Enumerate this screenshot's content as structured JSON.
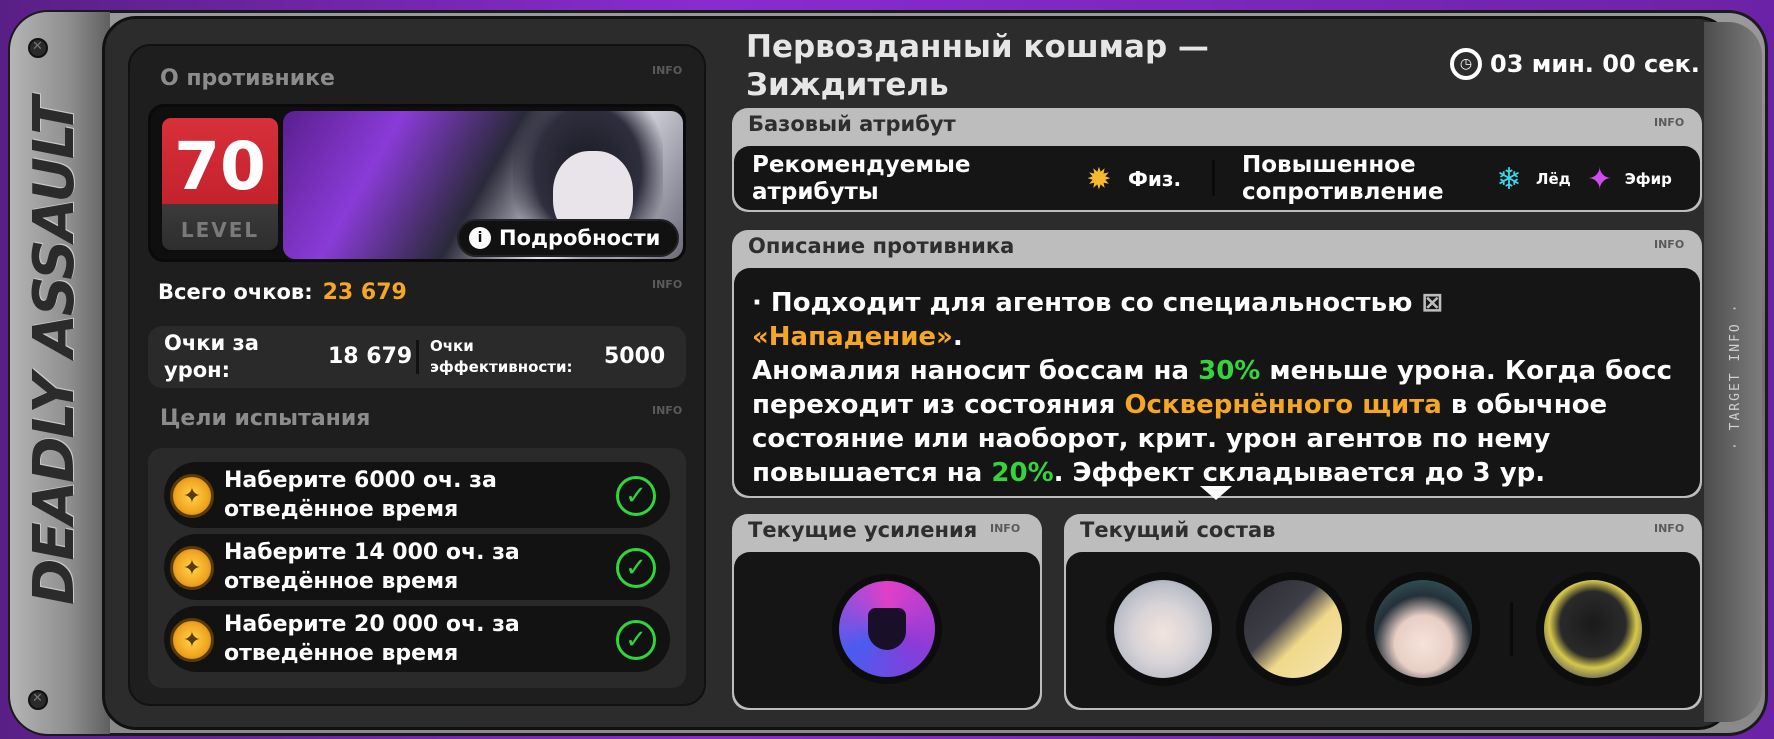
{
  "side_title": "DEADLY ASSAULT",
  "right_rail_text": "· TARGET INFO ·",
  "info_tag": "INFO",
  "enemy": {
    "section_label": "О противнике",
    "level": "70",
    "level_word": "LEVEL",
    "details_label": "Подробности"
  },
  "scores": {
    "total_label": "Всего очков:",
    "total_value": "23 679",
    "damage_label": "Очки за урон:",
    "damage_value": "18 679",
    "efficiency_label": "Очки эффективности:",
    "efficiency_value": "5000"
  },
  "goals": {
    "section_label": "Цели испытания",
    "items": [
      {
        "text": "Наберите 6000 оч. за отведённое время",
        "done": true
      },
      {
        "text": "Наберите 14 000 оч. за отведённое время",
        "done": true
      },
      {
        "text": "Наберите 20 000 оч. за отведённое время",
        "done": true
      }
    ]
  },
  "boss": {
    "title": "Первозданный кошмар — Зиждитель",
    "timer": "03 мин. 00 сек."
  },
  "attributes": {
    "tab_label": "Базовый атрибут",
    "recommended_label": "Рекомендуемые атрибуты",
    "recommended": [
      {
        "name": "Физ.",
        "icon": "physical-icon",
        "color": "#f5b82e"
      }
    ],
    "resistance_label": "Повышенное сопротивление",
    "resistances": [
      {
        "name": "Лёд",
        "icon": "ice-icon",
        "color": "#3ad7e8"
      },
      {
        "name": "Эфир",
        "icon": "ether-icon",
        "color": "#d14cf0"
      }
    ]
  },
  "description": {
    "tab_label": "Описание противника",
    "line1": "· Подходит для агентов со специальностью",
    "specialty": "«Нападение»",
    "p1": "Аномалия наносит боссам на",
    "pct1": "30%",
    "p2": "меньше урона. Когда босс переходит из состояния",
    "shield": "Осквернённого щита",
    "p3": "в обычное состояние или наоборот, крит. урон агентов по нему повышается на",
    "pct2": "20%",
    "p4": ". Эффект складывается до 3 ур."
  },
  "buffs": {
    "tab_label": "Текущие усиления"
  },
  "team": {
    "tab_label": "Текущий состав"
  },
  "colors": {
    "accent_orange": "#f5a623",
    "accent_green": "#35d43d",
    "level_red": "#d8303b"
  }
}
